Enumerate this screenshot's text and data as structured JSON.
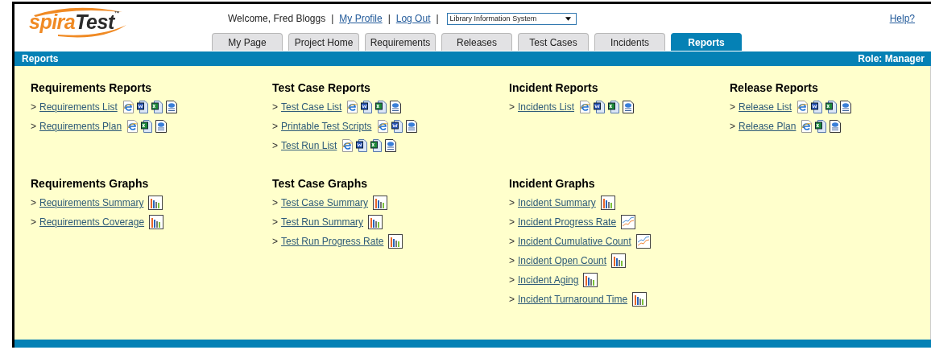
{
  "logo": {
    "first": "spira",
    "second": "Test",
    "mark": "™"
  },
  "header": {
    "welcome": "Welcome, Fred Bloggs",
    "links": [
      {
        "separator": "|",
        "label": "My Profile"
      },
      {
        "separator": "|",
        "label": "Log Out"
      }
    ],
    "project_separator": "|",
    "project": "Library Information System",
    "help": "Help?"
  },
  "tabs": [
    {
      "label": "My Page",
      "selected": false
    },
    {
      "label": "Project Home",
      "selected": false
    },
    {
      "label": "Requirements",
      "selected": false
    },
    {
      "label": "Releases",
      "selected": false
    },
    {
      "label": "Test Cases",
      "selected": false
    },
    {
      "label": "Incidents",
      "selected": false
    },
    {
      "label": "Reports",
      "selected": true
    }
  ],
  "title_bar": {
    "title": "Reports",
    "role": "Role: Manager"
  },
  "sections": [
    {
      "title": "Requirements Reports",
      "items": [
        {
          "bullet": ">",
          "label": "Requirements List",
          "icons": [
            {
              "kind": "html"
            },
            {
              "kind": "word"
            },
            {
              "kind": "excel"
            },
            {
              "kind": "xml"
            }
          ]
        },
        {
          "bullet": ">",
          "label": "Requirements Plan",
          "icons": [
            {
              "kind": "html"
            },
            {
              "kind": "excel"
            },
            {
              "kind": "xml"
            }
          ]
        }
      ]
    },
    {
      "title": "Test Case Reports",
      "items": [
        {
          "bullet": ">",
          "label": "Test Case List",
          "icons": [
            {
              "kind": "html"
            },
            {
              "kind": "word"
            },
            {
              "kind": "excel"
            },
            {
              "kind": "xml"
            }
          ]
        },
        {
          "bullet": ">",
          "label": "Printable Test Scripts",
          "icons": [
            {
              "kind": "html"
            },
            {
              "kind": "word"
            },
            {
              "kind": "xml"
            }
          ]
        },
        {
          "bullet": ">",
          "label": "Test Run List",
          "icons": [
            {
              "kind": "html"
            },
            {
              "kind": "word"
            },
            {
              "kind": "excel"
            },
            {
              "kind": "xml"
            }
          ]
        }
      ]
    },
    {
      "title": "Incident Reports",
      "items": [
        {
          "bullet": ">",
          "label": "Incidents List",
          "icons": [
            {
              "kind": "html"
            },
            {
              "kind": "word"
            },
            {
              "kind": "excel"
            },
            {
              "kind": "xml"
            }
          ]
        }
      ]
    },
    {
      "title": "Release Reports",
      "items": [
        {
          "bullet": ">",
          "label": "Release List",
          "icons": [
            {
              "kind": "html"
            },
            {
              "kind": "word"
            },
            {
              "kind": "excel"
            },
            {
              "kind": "xml"
            }
          ]
        },
        {
          "bullet": ">",
          "label": "Release Plan",
          "icons": [
            {
              "kind": "html"
            },
            {
              "kind": "excel"
            },
            {
              "kind": "xml"
            }
          ]
        }
      ]
    },
    {
      "title": "Requirements Graphs",
      "items": [
        {
          "bullet": ">",
          "label": "Requirements Summary",
          "icons": [
            {
              "kind": "bar"
            }
          ]
        },
        {
          "bullet": ">",
          "label": "Requirements Coverage",
          "icons": [
            {
              "kind": "bar"
            }
          ]
        }
      ]
    },
    {
      "title": "Test Case Graphs",
      "items": [
        {
          "bullet": ">",
          "label": "Test Case Summary",
          "icons": [
            {
              "kind": "bar"
            }
          ]
        },
        {
          "bullet": ">",
          "label": "Test Run Summary",
          "icons": [
            {
              "kind": "bar"
            }
          ]
        },
        {
          "bullet": ">",
          "label": "Test Run Progress Rate",
          "icons": [
            {
              "kind": "bar"
            }
          ]
        }
      ]
    },
    {
      "title": "Incident Graphs",
      "items": [
        {
          "bullet": ">",
          "label": "Incident Summary",
          "icons": [
            {
              "kind": "bar"
            }
          ]
        },
        {
          "bullet": ">",
          "label": "Incident Progress Rate",
          "icons": [
            {
              "kind": "line"
            }
          ]
        },
        {
          "bullet": ">",
          "label": "Incident Cumulative Count",
          "icons": [
            {
              "kind": "line"
            }
          ]
        },
        {
          "bullet": ">",
          "label": "Incident Open Count",
          "icons": [
            {
              "kind": "bar"
            }
          ]
        },
        {
          "bullet": ">",
          "label": "Incident Aging",
          "icons": [
            {
              "kind": "bar"
            }
          ]
        },
        {
          "bullet": ">",
          "label": "Incident Turnaround Time",
          "icons": [
            {
              "kind": "bar"
            }
          ]
        }
      ]
    }
  ]
}
